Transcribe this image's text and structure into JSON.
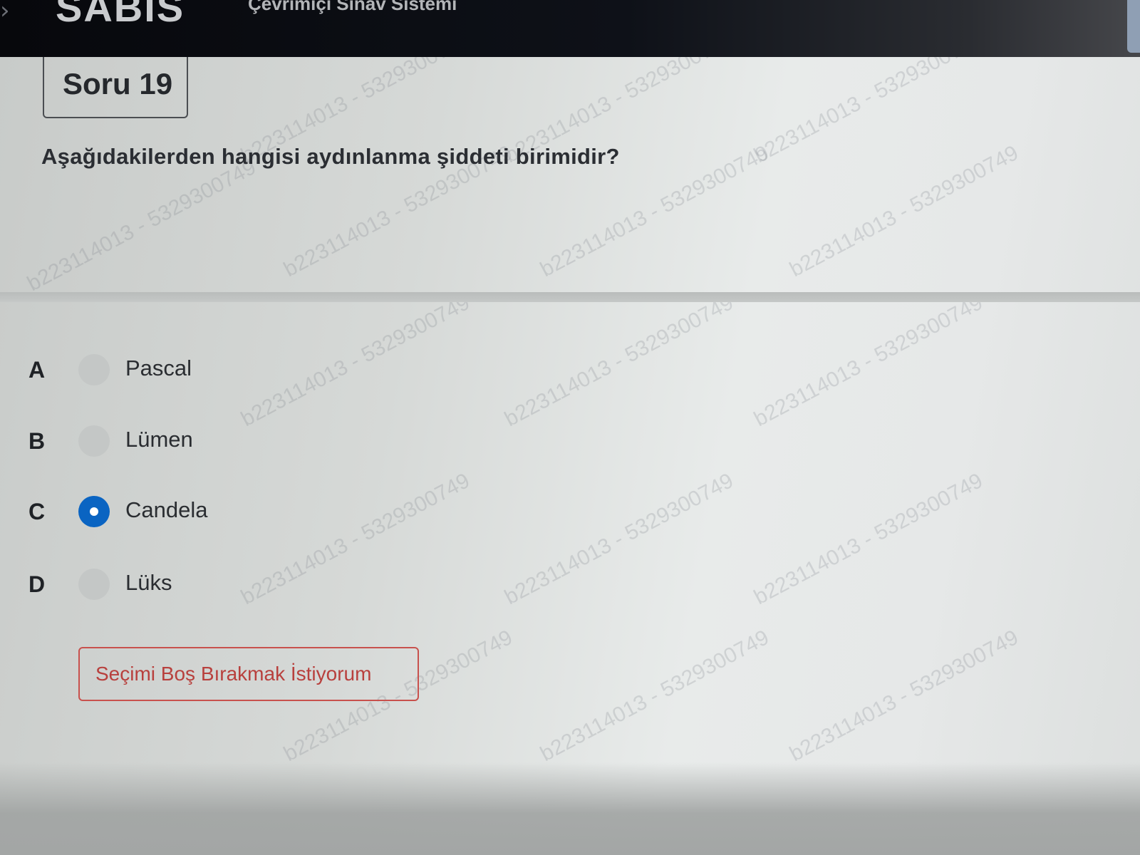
{
  "header": {
    "brand": "SABIS",
    "subtitle": "Çevrimiçi Sınav Sistemi",
    "nav_icon": "chevron-right-icon"
  },
  "question": {
    "number_label": "Soru 19",
    "text": "Aşağıdakilerden hangisi aydınlanma şiddeti birimidir?",
    "options": [
      {
        "letter": "A",
        "label": "Pascal",
        "selected": false
      },
      {
        "letter": "B",
        "label": "Lümen",
        "selected": false
      },
      {
        "letter": "C",
        "label": "Candela",
        "selected": true
      },
      {
        "letter": "D",
        "label": "Lüks",
        "selected": false
      }
    ]
  },
  "actions": {
    "leave_blank_label": "Seçimi Boş Bırakmak İstiyorum"
  },
  "watermark": {
    "text": "b223114013 - 5329300749"
  },
  "colors": {
    "header_bg": "#0b0d12",
    "selected_radio": "#0a64c2",
    "danger_border": "#c8514d",
    "danger_text": "#b8403d"
  }
}
